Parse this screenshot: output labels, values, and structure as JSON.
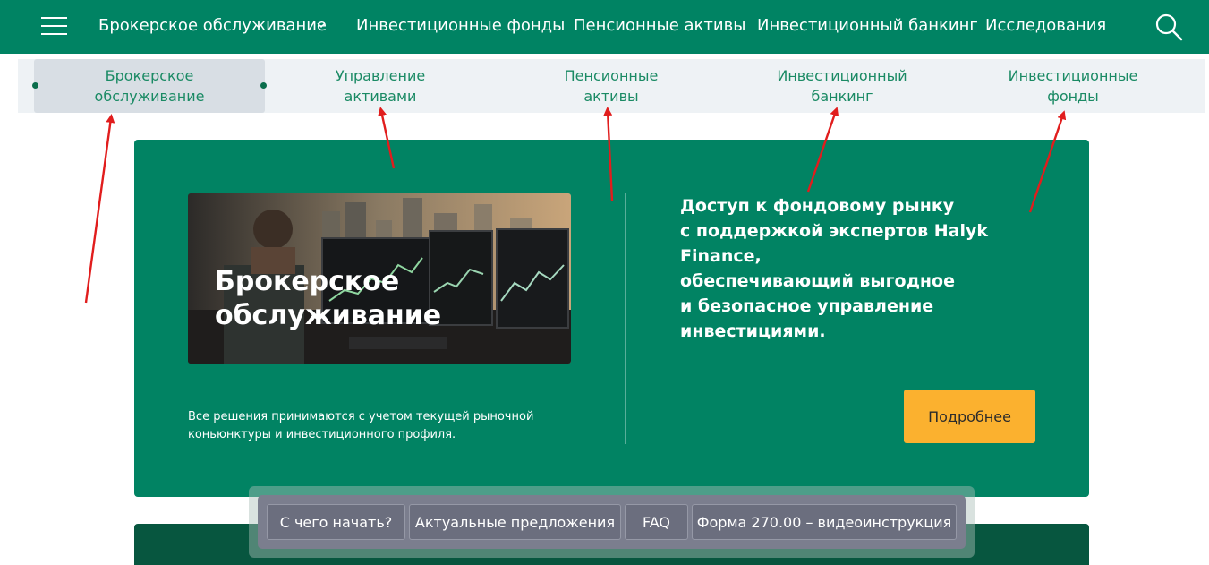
{
  "topnav": {
    "items": [
      {
        "label": "Брокерское обслуживание"
      },
      {
        "label": "Инвестиционные фонды"
      },
      {
        "label": "Пенсионные активы"
      },
      {
        "label": "Инвестиционный банкинг"
      },
      {
        "label": "Исследования"
      }
    ],
    "menu_icon": "hamburger-menu-icon",
    "search_icon": "search-icon"
  },
  "subnav": {
    "items": [
      {
        "label": "Брокерское обслуживание",
        "active": true
      },
      {
        "label": "Управление активами"
      },
      {
        "label": "Пенсионные активы"
      },
      {
        "label": "Инвестиционный банкинг"
      },
      {
        "label": "Инвестиционные фонды"
      }
    ]
  },
  "card": {
    "hero_title": "Брокерское обслуживание",
    "note": "Все решения принимаются с учетом текущей рыночной коньюнктуры и инвестиционного профиля.",
    "description": "Доступ к фондовому рынку\nс поддержкой экспертов Halyk Finance,\nобеспечивающий выгодное\nи безопасное управление\nинвестициями.",
    "button_label": "Подробнее"
  },
  "floatbar": {
    "tabs": [
      {
        "label": "С чего начать?"
      },
      {
        "label": "Актуальные предложения"
      },
      {
        "label": "FAQ"
      },
      {
        "label": "Форма 270.00 – видеоинструкция"
      }
    ]
  },
  "colors": {
    "brand_green": "#008363",
    "accent_yellow": "#fbb12f",
    "annotation_red": "#e11d1d"
  }
}
